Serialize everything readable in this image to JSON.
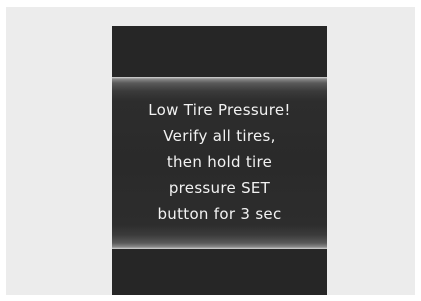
{
  "warning": {
    "lines": [
      "Low Tire Pressure!",
      "Verify all tires,",
      "then hold tire",
      "pressure SET",
      "button for 3 sec"
    ]
  }
}
